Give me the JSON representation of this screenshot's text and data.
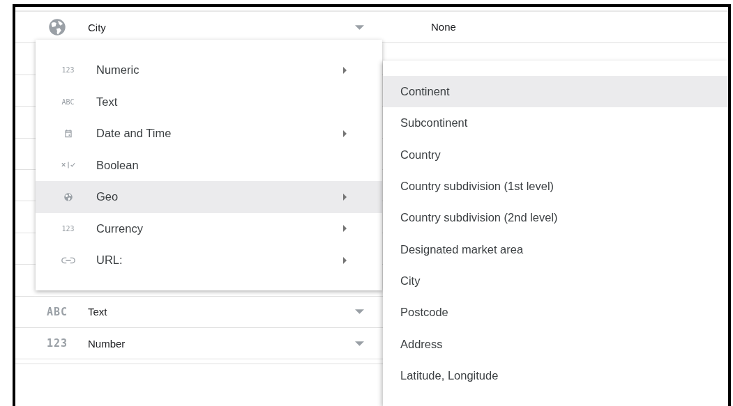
{
  "rows": [
    {
      "kind": "geo",
      "type": "City",
      "aggregation": "None"
    },
    {},
    {},
    {},
    {},
    {},
    {},
    {},
    {},
    {
      "kind": "glyph",
      "icon_label": "ABC",
      "type": "Text"
    },
    {
      "kind": "glyph",
      "icon_label": "123",
      "type": "Number"
    }
  ],
  "type_menu": {
    "items": [
      {
        "kind": "glyph",
        "icon_label": "123",
        "label": "Numeric",
        "has_submenu": true,
        "selected": false
      },
      {
        "kind": "glyph",
        "icon_label": "ABC",
        "label": "Text",
        "has_submenu": false,
        "selected": false
      },
      {
        "kind": "calendar",
        "label": "Date and Time",
        "has_submenu": true,
        "selected": false
      },
      {
        "kind": "boolean",
        "label": "Boolean",
        "has_submenu": false,
        "selected": false
      },
      {
        "kind": "geo",
        "label": "Geo",
        "has_submenu": true,
        "selected": true
      },
      {
        "kind": "glyph",
        "icon_label": "123",
        "label": "Currency",
        "has_submenu": true,
        "selected": false
      },
      {
        "kind": "link",
        "label": "URL:",
        "has_submenu": true,
        "selected": false
      }
    ]
  },
  "geo_submenu": {
    "items": [
      {
        "label": "Continent",
        "selected": true
      },
      {
        "label": "Subcontinent",
        "selected": false
      },
      {
        "label": "Country",
        "selected": false
      },
      {
        "label": "Country subdivision (1st level)",
        "selected": false
      },
      {
        "label": "Country subdivision (2nd level)",
        "selected": false
      },
      {
        "label": "Designated market area",
        "selected": false
      },
      {
        "label": "City",
        "selected": false
      },
      {
        "label": "Postcode",
        "selected": false
      },
      {
        "label": "Address",
        "selected": false
      },
      {
        "label": "Latitude, Longitude",
        "selected": false
      }
    ]
  }
}
